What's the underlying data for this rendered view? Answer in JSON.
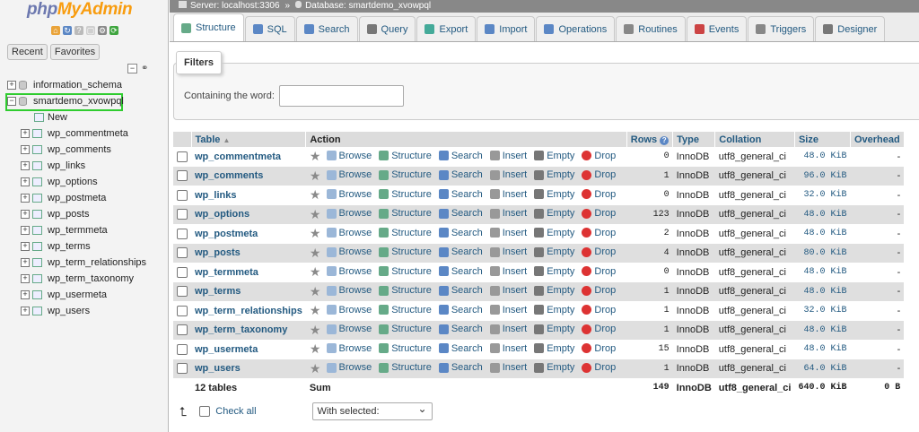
{
  "nav": {
    "logo_php": "php",
    "logo_myadmin": "MyAdmin",
    "recent": "Recent",
    "favorites": "Favorites",
    "databases": [
      {
        "name": "information_schema",
        "selected": false
      },
      {
        "name": "smartdemo_xvowpql",
        "selected": true
      }
    ],
    "new_label": "New",
    "tables": [
      "wp_commentmeta",
      "wp_comments",
      "wp_links",
      "wp_options",
      "wp_postmeta",
      "wp_posts",
      "wp_termmeta",
      "wp_terms",
      "wp_term_relationships",
      "wp_term_taxonomy",
      "wp_usermeta",
      "wp_users"
    ]
  },
  "breadcrumb": {
    "server": "Server: localhost:3306",
    "separator": "»",
    "database": "Database: smartdemo_xvowpql"
  },
  "tabs": [
    "Structure",
    "SQL",
    "Search",
    "Query",
    "Export",
    "Import",
    "Operations",
    "Routines",
    "Events",
    "Triggers",
    "Designer"
  ],
  "active_tab": "Structure",
  "filters": {
    "legend": "Filters",
    "label": "Containing the word:",
    "value": ""
  },
  "table": {
    "headers": {
      "table": "Table",
      "action": "Action",
      "rows": "Rows",
      "type": "Type",
      "collation": "Collation",
      "size": "Size",
      "overhead": "Overhead"
    },
    "actions": {
      "browse": "Browse",
      "structure": "Structure",
      "search": "Search",
      "insert": "Insert",
      "empty": "Empty",
      "drop": "Drop"
    },
    "rows": [
      {
        "name": "wp_commentmeta",
        "rows": "0",
        "type": "InnoDB",
        "collation": "utf8_general_ci",
        "size": "48.0 KiB",
        "overhead": "-"
      },
      {
        "name": "wp_comments",
        "rows": "1",
        "type": "InnoDB",
        "collation": "utf8_general_ci",
        "size": "96.0 KiB",
        "overhead": "-"
      },
      {
        "name": "wp_links",
        "rows": "0",
        "type": "InnoDB",
        "collation": "utf8_general_ci",
        "size": "32.0 KiB",
        "overhead": "-"
      },
      {
        "name": "wp_options",
        "rows": "123",
        "type": "InnoDB",
        "collation": "utf8_general_ci",
        "size": "48.0 KiB",
        "overhead": "-"
      },
      {
        "name": "wp_postmeta",
        "rows": "2",
        "type": "InnoDB",
        "collation": "utf8_general_ci",
        "size": "48.0 KiB",
        "overhead": "-"
      },
      {
        "name": "wp_posts",
        "rows": "4",
        "type": "InnoDB",
        "collation": "utf8_general_ci",
        "size": "80.0 KiB",
        "overhead": "-"
      },
      {
        "name": "wp_termmeta",
        "rows": "0",
        "type": "InnoDB",
        "collation": "utf8_general_ci",
        "size": "48.0 KiB",
        "overhead": "-"
      },
      {
        "name": "wp_terms",
        "rows": "1",
        "type": "InnoDB",
        "collation": "utf8_general_ci",
        "size": "48.0 KiB",
        "overhead": "-"
      },
      {
        "name": "wp_term_relationships",
        "rows": "1",
        "type": "InnoDB",
        "collation": "utf8_general_ci",
        "size": "32.0 KiB",
        "overhead": "-"
      },
      {
        "name": "wp_term_taxonomy",
        "rows": "1",
        "type": "InnoDB",
        "collation": "utf8_general_ci",
        "size": "48.0 KiB",
        "overhead": "-"
      },
      {
        "name": "wp_usermeta",
        "rows": "15",
        "type": "InnoDB",
        "collation": "utf8_general_ci",
        "size": "48.0 KiB",
        "overhead": "-"
      },
      {
        "name": "wp_users",
        "rows": "1",
        "type": "InnoDB",
        "collation": "utf8_general_ci",
        "size": "64.0 KiB",
        "overhead": "-"
      }
    ],
    "summary": {
      "count": "12 tables",
      "label": "Sum",
      "rows": "149",
      "type": "InnoDB",
      "collation": "utf8_general_ci",
      "size": "640.0 KiB",
      "overhead": "0 B"
    }
  },
  "footer": {
    "check_all": "Check all",
    "with_selected": "With selected:"
  },
  "colors": {
    "link": "#235a81",
    "highlight": "#2fcc2f",
    "drop": "#dd3333"
  }
}
